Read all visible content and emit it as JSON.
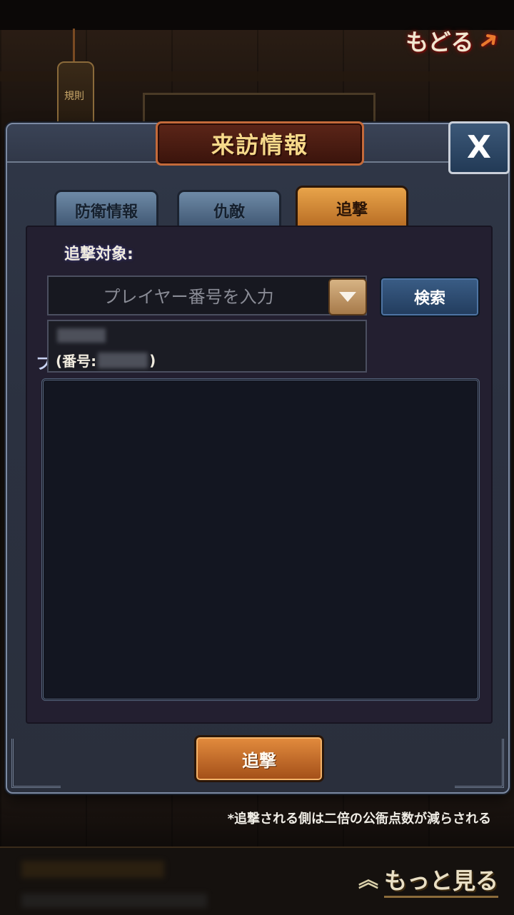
{
  "background": {
    "back_label": "もどる",
    "rules_label": "規則",
    "more_label": "もっと見る",
    "footnote": "*追撃される側は二倍の公衙点数が減らされる"
  },
  "dialog": {
    "title": "来訪情報",
    "close_label": "X",
    "tabs": [
      {
        "label": "防衛情報",
        "active": false
      },
      {
        "label": "仇敵",
        "active": false
      },
      {
        "label": "追撃",
        "active": true
      }
    ],
    "target_label": "追撃対象:",
    "input_placeholder": "プレイヤー番号を入力",
    "search_label": "検索",
    "suggestion": {
      "id_prefix": "(番号:",
      "id_suffix": ")"
    },
    "partial_letter": "フ",
    "pursue_button": "追撃"
  },
  "colors": {
    "accent_orange": "#e38c3e",
    "title_gold": "#f6d98a",
    "panel_bg": "#231f30"
  }
}
